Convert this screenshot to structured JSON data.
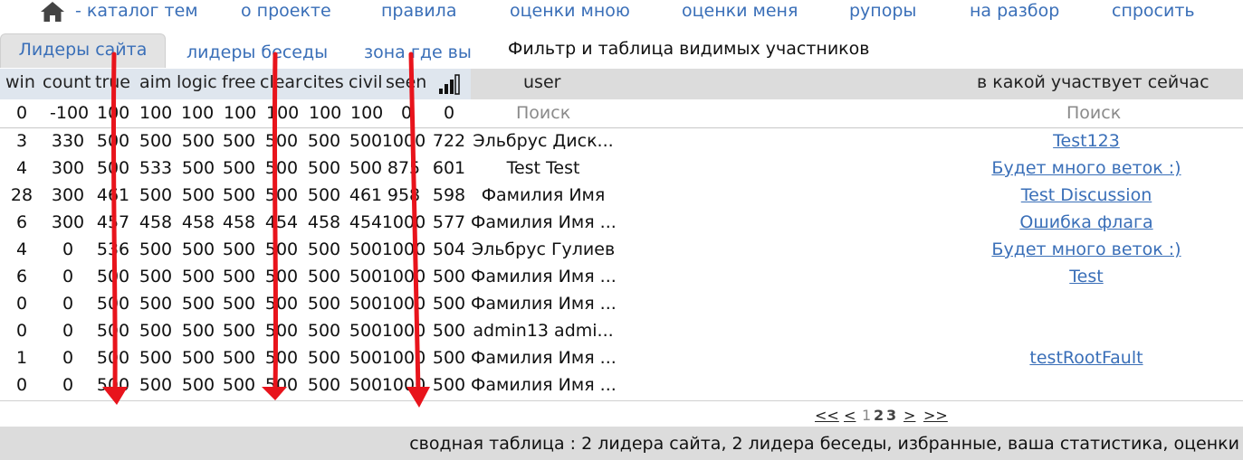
{
  "nav": {
    "items": [
      "- каталог тем",
      "о проекте",
      "правила",
      "оценки мною",
      "оценки меня",
      "рупоры",
      "на разбор",
      "спросить"
    ]
  },
  "tabs": {
    "items": [
      "Лидеры сайта",
      "лидеры беседы",
      "зона где вы"
    ],
    "title": "Фильтр и таблица видимых участников"
  },
  "table": {
    "columns": [
      "win",
      "count",
      "true",
      "aim",
      "logic",
      "free",
      "clear",
      "cites",
      "civil",
      "seen",
      "",
      "user",
      "в какой участвует сейчас"
    ],
    "rating_column_icon": "bar-chart-icon",
    "filters": [
      "0",
      "-100",
      "100",
      "100",
      "100",
      "100",
      "100",
      "100",
      "100",
      "0",
      "0"
    ],
    "search_placeholder_user": "Поиск",
    "search_placeholder_disc": "Поиск",
    "rows": [
      {
        "v": [
          "3",
          "330",
          "500",
          "500",
          "500",
          "500",
          "500",
          "500",
          "500",
          "1000",
          "722"
        ],
        "user": "Эльбрус Диск...",
        "disc": "Test123"
      },
      {
        "v": [
          "4",
          "300",
          "500",
          "533",
          "500",
          "500",
          "500",
          "500",
          "500",
          "875",
          "601"
        ],
        "user": "Test Test",
        "disc": "Будет много веток :)"
      },
      {
        "v": [
          "28",
          "300",
          "461",
          "500",
          "500",
          "500",
          "500",
          "500",
          "461",
          "958",
          "598"
        ],
        "user": "Фамилия Имя",
        "disc": "Test Discussion"
      },
      {
        "v": [
          "6",
          "300",
          "457",
          "458",
          "458",
          "458",
          "454",
          "458",
          "454",
          "1000",
          "577"
        ],
        "user": "Фамилия Имя ...",
        "disc": "Ошибка флага"
      },
      {
        "v": [
          "4",
          "0",
          "536",
          "500",
          "500",
          "500",
          "500",
          "500",
          "500",
          "1000",
          "504"
        ],
        "user": "Эльбрус Гулиев",
        "disc": "Будет много веток :)"
      },
      {
        "v": [
          "6",
          "0",
          "500",
          "500",
          "500",
          "500",
          "500",
          "500",
          "500",
          "1000",
          "500"
        ],
        "user": "Фамилия Имя ...",
        "disc": "Test"
      },
      {
        "v": [
          "0",
          "0",
          "500",
          "500",
          "500",
          "500",
          "500",
          "500",
          "500",
          "1000",
          "500"
        ],
        "user": "Фамилия Имя ...",
        "disc": ""
      },
      {
        "v": [
          "0",
          "0",
          "500",
          "500",
          "500",
          "500",
          "500",
          "500",
          "500",
          "1000",
          "500"
        ],
        "user": "admin13 admi...",
        "disc": ""
      },
      {
        "v": [
          "1",
          "0",
          "500",
          "500",
          "500",
          "500",
          "500",
          "500",
          "500",
          "1000",
          "500"
        ],
        "user": "Фамилия Имя ...",
        "disc": "testRootFault"
      },
      {
        "v": [
          "0",
          "0",
          "500",
          "500",
          "500",
          "500",
          "500",
          "500",
          "500",
          "1000",
          "500"
        ],
        "user": "Фамилия Имя ...",
        "disc": ""
      }
    ]
  },
  "pager": {
    "first": "<<",
    "prev": "<",
    "pages": [
      "1",
      "2",
      "3"
    ],
    "current": "1",
    "next": ">",
    "last": ">>"
  },
  "footer": {
    "text": "сводная таблица : 2 лидера сайта, 2 лидера беседы, избранные, ваша статистика, оценки"
  },
  "colors": {
    "link": "#3a6fb8",
    "header_bg": "#dcdcdc",
    "arrow": "#e8141c"
  }
}
